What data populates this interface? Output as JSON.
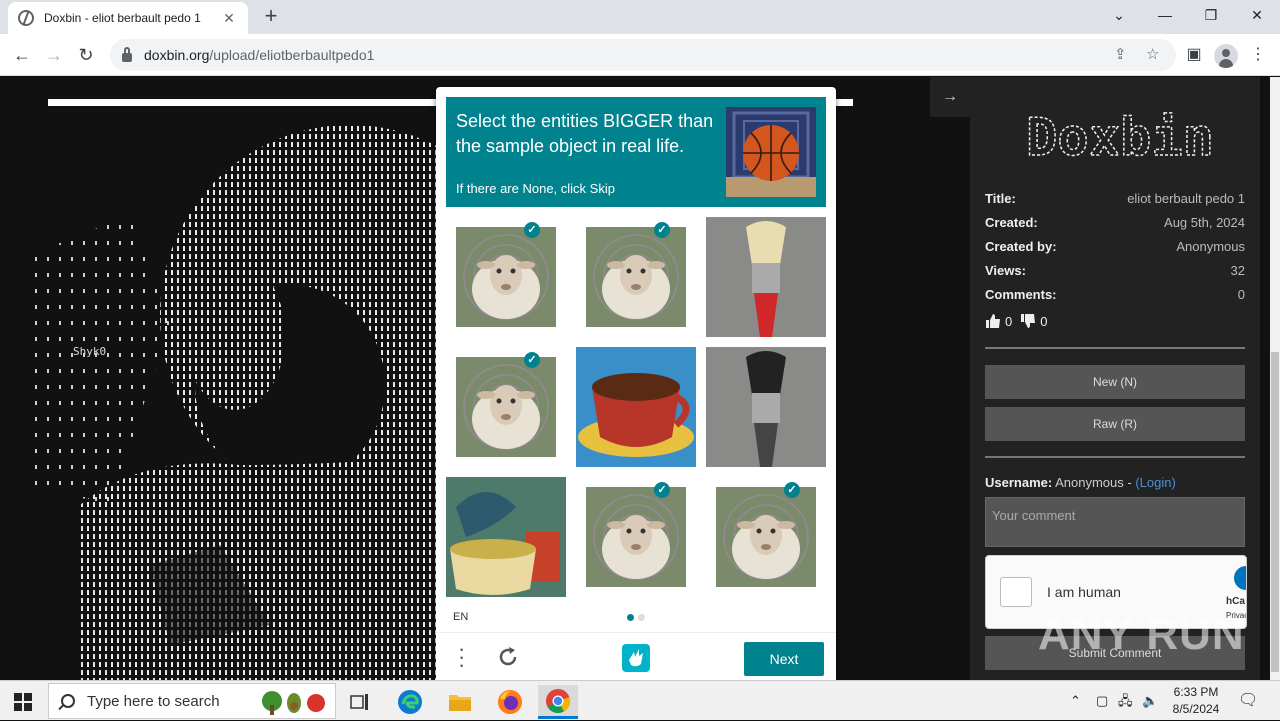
{
  "browser": {
    "tab_title": "Doxbin - eliot berbault pedo 1",
    "tab_close": "✕",
    "new_tab": "+",
    "url_host": "doxbin.org",
    "url_path": "/upload/eliotberbaultpedo1",
    "window_controls": {
      "dropdown": "⌄",
      "minimize": "—",
      "restore": "❐",
      "close": "✕"
    }
  },
  "page": {
    "ascii_tag": "Shyk0",
    "collapse_arrow": "→"
  },
  "sidebar": {
    "logo_text": "Doxbin",
    "meta": [
      {
        "key": "Title:",
        "value": "eliot berbault pedo 1"
      },
      {
        "key": "Created:",
        "value": "Aug 5th, 2024"
      },
      {
        "key": "Created by:",
        "value": "Anonymous"
      },
      {
        "key": "Views:",
        "value": "32"
      },
      {
        "key": "Comments:",
        "value": "0"
      }
    ],
    "likes": "0",
    "dislikes": "0",
    "new_button": "New (N)",
    "raw_button": "Raw (R)",
    "username_label": "Username:",
    "username_value": "Anonymous -",
    "login_link": "(Login)",
    "comment_placeholder": "Your comment",
    "hcaptcha_label": "I am human",
    "hcaptcha_brand": "hCa",
    "hcaptcha_privacy": "Privac",
    "submit_button": "Submit Comment"
  },
  "captcha": {
    "prompt": "Select the entities BIGGER than the sample object in real life.",
    "subprompt": "If there are None, click Skip",
    "language": "EN",
    "next_button": "Next",
    "tiles": [
      {
        "subject": "sheep",
        "selected": true
      },
      {
        "subject": "sheep",
        "selected": true
      },
      {
        "subject": "paintbrush",
        "selected": false
      },
      {
        "subject": "sheep",
        "selected": true
      },
      {
        "subject": "coffee-cup",
        "selected": false
      },
      {
        "subject": "paintbrush",
        "selected": false
      },
      {
        "subject": "teacup-painting",
        "selected": false
      },
      {
        "subject": "sheep",
        "selected": true
      },
      {
        "subject": "sheep",
        "selected": true
      }
    ],
    "accent_color": "#00838f"
  },
  "watermark": "ANY RUN",
  "taskbar": {
    "search_placeholder": "Type here to search",
    "time": "6:33 PM",
    "date": "8/5/2024"
  }
}
